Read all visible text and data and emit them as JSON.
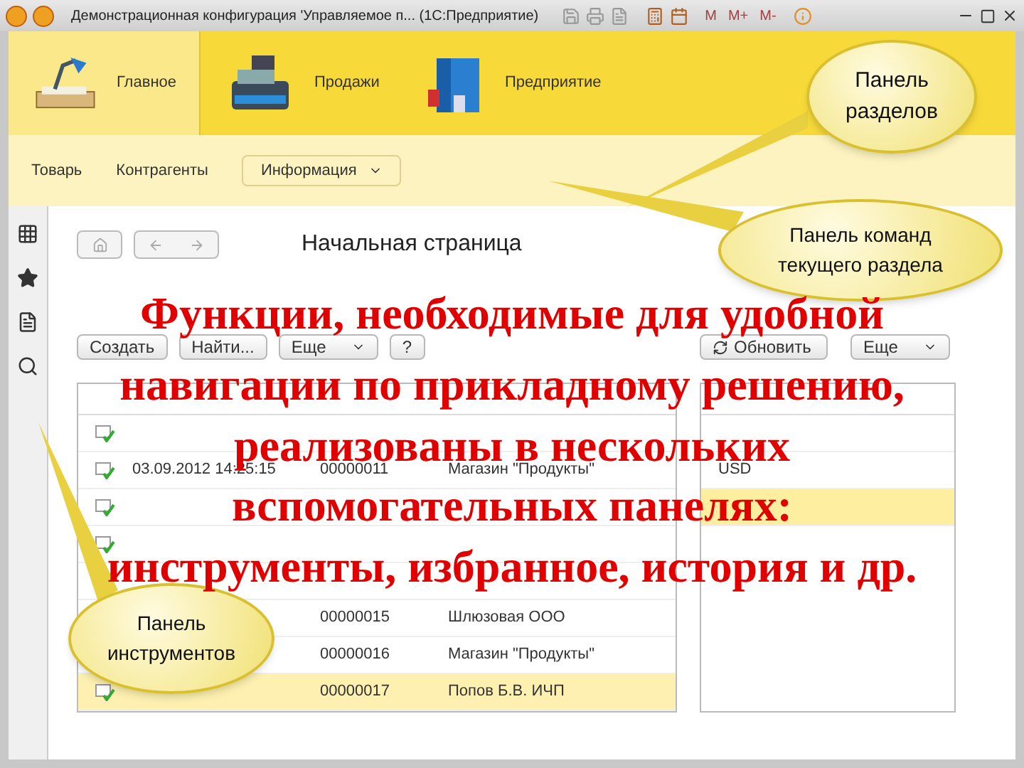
{
  "window": {
    "title": "Демонстрационная конфигурация 'Управляемое п... (1С:Предприятие)",
    "memory_buttons": [
      "M",
      "M+",
      "M-"
    ]
  },
  "sections": [
    {
      "label": "Главное",
      "selected": true
    },
    {
      "label": "Продажи",
      "selected": false
    },
    {
      "label": "Предприятие",
      "selected": false
    }
  ],
  "commands": [
    {
      "kind": "link",
      "label": "Товарь"
    },
    {
      "kind": "link",
      "label": "Контрагенты"
    },
    {
      "kind": "menu",
      "label": "Информация"
    }
  ],
  "page_title": "Начальная страница",
  "sales": {
    "buttons": [
      {
        "kind": "plain",
        "label": "Создать"
      },
      {
        "kind": "plain",
        "label": "Найти..."
      },
      {
        "kind": "menu",
        "label": "Еще"
      },
      {
        "kind": "plain",
        "label": "?"
      }
    ],
    "rows": [
      {
        "cells": [],
        "selected": false
      },
      {
        "cells": [
          "03.09.2012 14:25:15",
          "00000011",
          "Магазин \"Продукты\""
        ],
        "selected": false
      },
      {
        "cells": [],
        "selected": false
      },
      {
        "cells": [],
        "selected": false
      },
      {
        "cells": [],
        "selected": false
      },
      {
        "cells": [
          "",
          "00000015",
          "Шлюзовая ООО"
        ],
        "selected": false
      },
      {
        "cells": [
          "",
          "00000016",
          "Магазин \"Продукты\""
        ],
        "selected": false
      },
      {
        "cells": [
          "",
          "00000017",
          "Попов Б.В. ИЧП"
        ],
        "selected": true
      }
    ]
  },
  "rates": {
    "buttons": [
      {
        "kind": "refresh",
        "label": "Обновить"
      },
      {
        "kind": "menu",
        "label": "Еще"
      }
    ],
    "rows": [
      {
        "cells": [],
        "selected": false
      },
      {
        "cells": [
          "USD"
        ],
        "selected": false
      },
      {
        "cells": [],
        "selected": true
      }
    ]
  },
  "callouts": [
    {
      "text": "Панель разделов"
    },
    {
      "text": "Панель команд текущего раздела"
    },
    {
      "text": "Панель инструментов"
    }
  ],
  "overlay_lines": [
    "Функции, необходимые для удобной",
    "навигации по прикладному решению,",
    "реализованы в нескольких",
    "вспомогательных панелях:",
    "инструменты, избранное, история и др."
  ]
}
